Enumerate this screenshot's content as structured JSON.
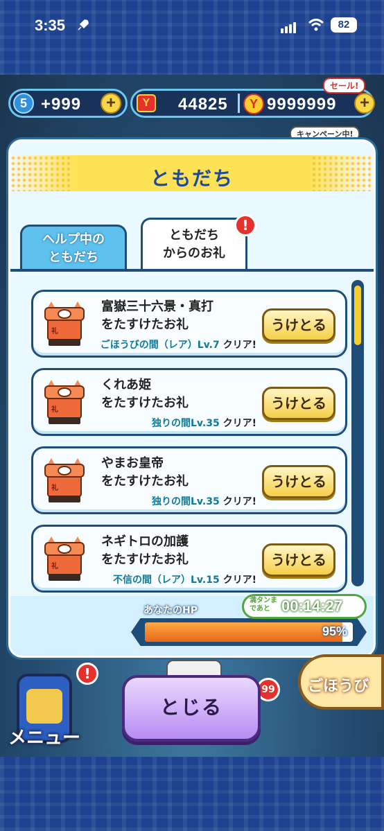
{
  "status_bar": {
    "time": "3:35",
    "battery": "82"
  },
  "currency": {
    "stamina_level": "5",
    "stamina_value": "+999",
    "ymoney_value": "44825",
    "coin_value": "9999999",
    "sale_badge": "セール!",
    "campaign_badge": "キャンペーン中!",
    "plus_symbol": "+"
  },
  "modal": {
    "title": "ともだち",
    "tabs": [
      {
        "line1": "ヘルプ中の",
        "line2": "ともだち"
      },
      {
        "line1": "ともだち",
        "line2": "からのお礼",
        "badge": "!"
      }
    ],
    "items": [
      {
        "name": "富嶽三十六景・真打",
        "subtitle": "をたすけたお礼",
        "condition": "ごほうびの間（レア）Lv.7",
        "clear": "クリア!",
        "button": "うけとる"
      },
      {
        "name": "くれあ姫",
        "subtitle": "をたすけたお礼",
        "condition": "独りの間Lv.35",
        "clear": "クリア!",
        "button": "うけとる"
      },
      {
        "name": "やまお皇帝",
        "subtitle": "をたすけたお礼",
        "condition": "独りの間Lv.35",
        "clear": "クリア!",
        "button": "うけとる"
      },
      {
        "name": "ネギトロの加護",
        "subtitle": "をたすけたお礼",
        "condition": "不信の間（レア）Lv.15",
        "clear": "クリア!",
        "button": "うけとる"
      }
    ],
    "ofuda_kanji": "礼"
  },
  "hp": {
    "label": "あなたのHP",
    "percent_text": "95%",
    "percent_value": 0.95,
    "full_label": "満タンまであと",
    "full_timer": "00:14:27"
  },
  "bottom": {
    "close_button": "とじる",
    "menu_label": "メニュー",
    "menu_badge": "!",
    "reward_label": "ごほうび",
    "notification_count": "99"
  },
  "colors": {
    "title_text": "#1d4a9a",
    "condition_text": "#0e7a9a",
    "hp_fill": "#e9661a",
    "accent_yellow": "#f6cf2e",
    "close_button": "#b88cf2"
  }
}
